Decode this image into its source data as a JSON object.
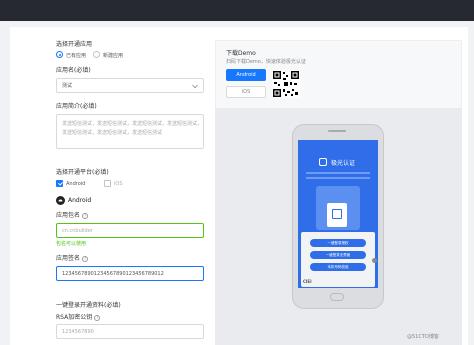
{
  "app_select": {
    "title": "选择开通应用",
    "options": [
      {
        "label": "已有应用",
        "selected": true
      },
      {
        "label": "新建应用",
        "selected": false
      }
    ]
  },
  "app_name": {
    "label": "应用名(必填)",
    "value": "测试"
  },
  "app_intro": {
    "label": "应用简介(必填)",
    "value": "发送短信测试，发送短信测试，发送短信测试，发送短信测试，发送短信测试，发送短信测试，发送短信测试"
  },
  "platform": {
    "title": "选择开通平台(必填)",
    "options": [
      {
        "label": "Android",
        "checked": true
      },
      {
        "label": "iOS",
        "checked": false
      }
    ],
    "tab_label": "Android"
  },
  "package_name": {
    "label": "应用包名",
    "placeholder": "cn.cnbuilder",
    "hint": "包名可以使用"
  },
  "signature": {
    "label": "应用签名",
    "value": "12345678901234567890123456789012"
  },
  "one_click": {
    "title": "一键登录开通资料(必填)"
  },
  "rsa": {
    "label": "RSA加密公钥",
    "placeholder": "1234567890"
  },
  "download": {
    "title": "下载Demo",
    "subtitle": "扫码下载Demo，快速体验极光认证",
    "android_button": "Android",
    "ios_button": "iOS"
  },
  "phone": {
    "header": "极光认证",
    "carrier": "CIEI",
    "option_1": "一键登录授权",
    "option_2": "一键登录无界面",
    "option_3": "本机号码校验"
  },
  "watermark": "@51CTO博客",
  "colors": {
    "accent": "#1677ff",
    "success": "#52c41a",
    "topbar": "#262a30"
  }
}
